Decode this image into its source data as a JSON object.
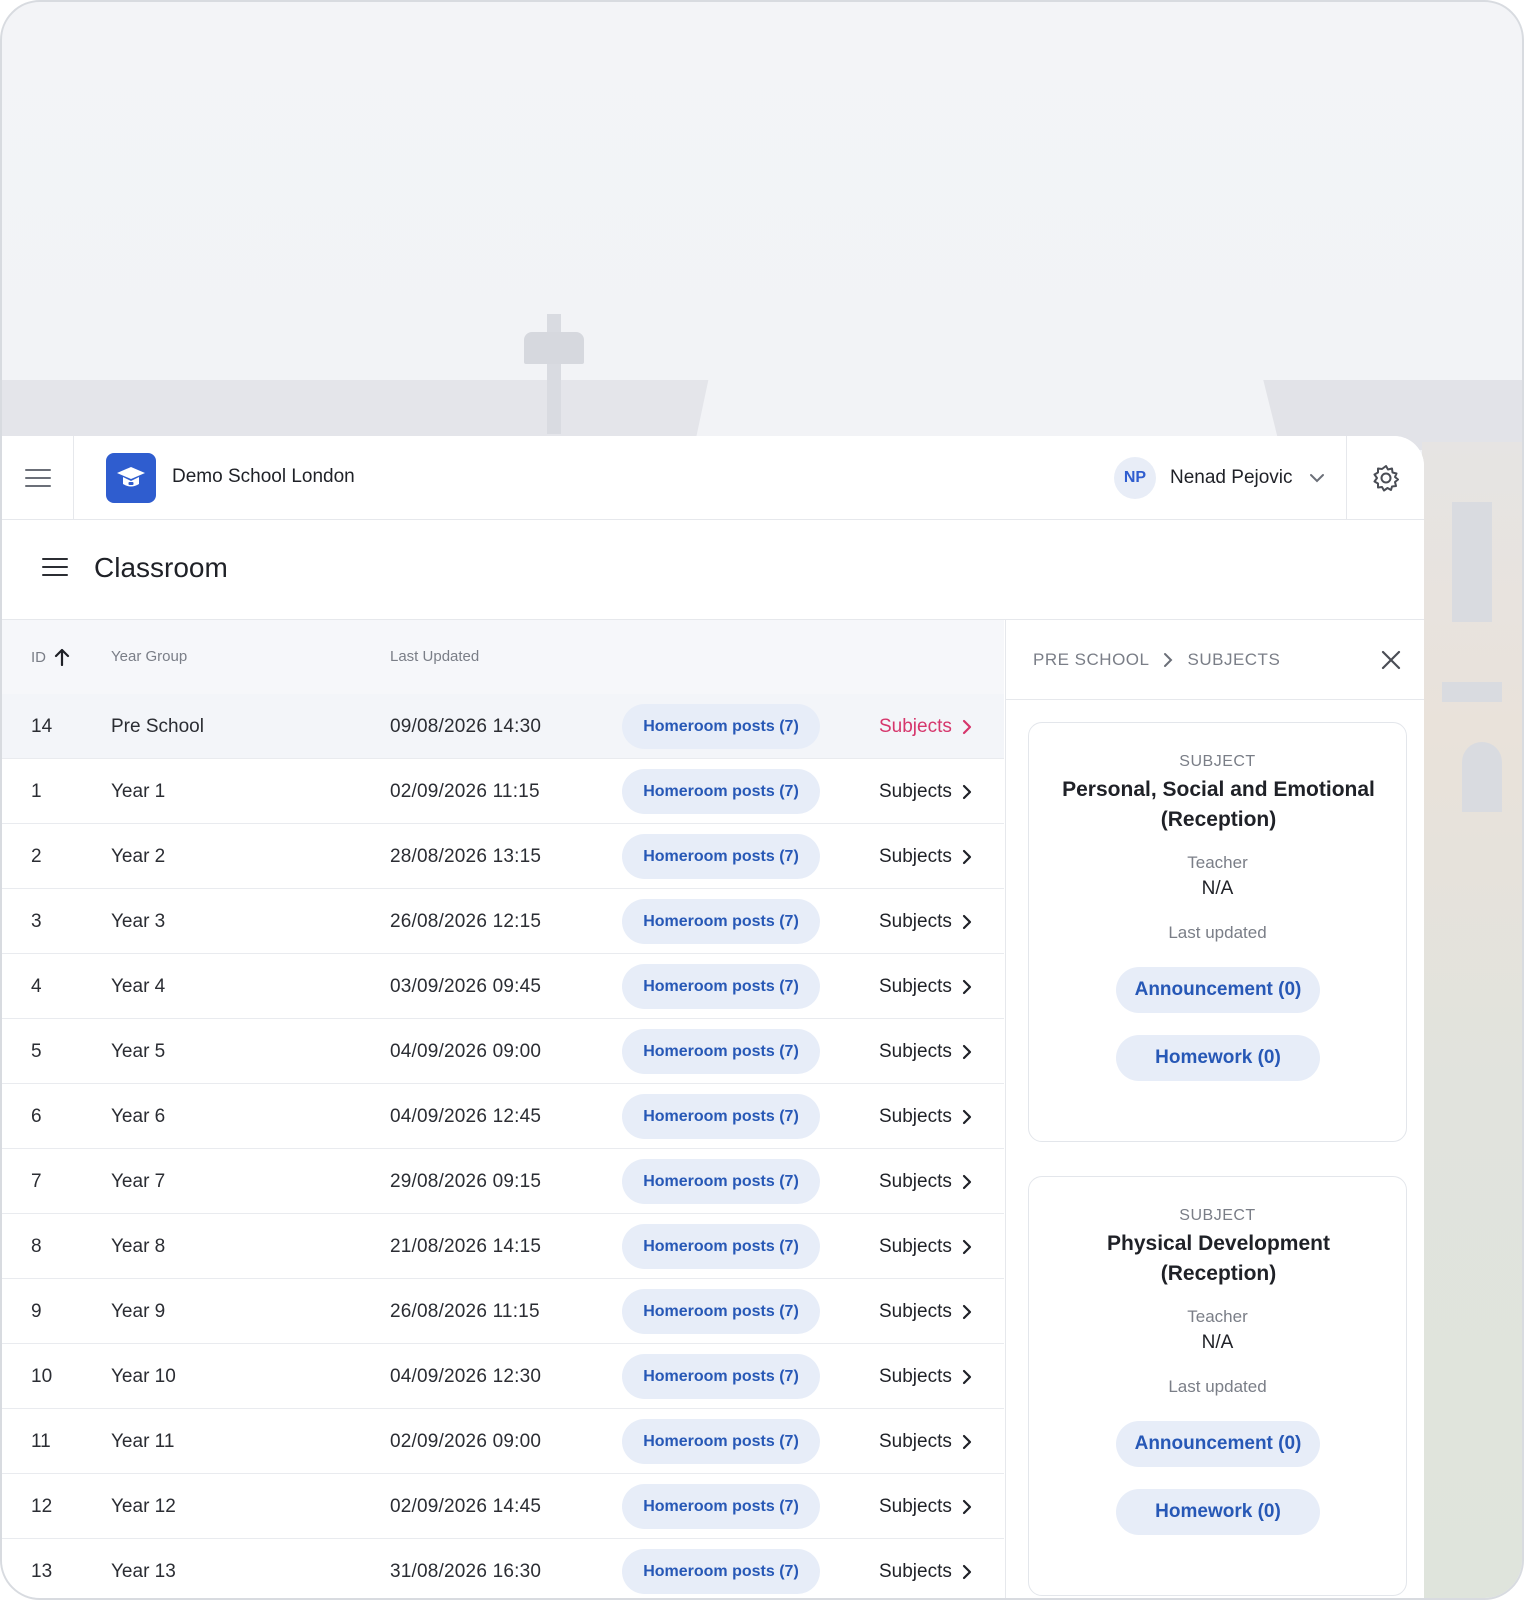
{
  "header": {
    "school_name": "Demo School London",
    "user_initials": "NP",
    "user_name": "Nenad Pejovic"
  },
  "page": {
    "title": "Classroom"
  },
  "table": {
    "columns": {
      "id": "ID",
      "year_group": "Year Group",
      "last_updated": "Last Updated"
    },
    "rows": [
      {
        "id": "14",
        "year": "Pre School",
        "updated": "09/08/2026 14:30",
        "posts": "Homeroom posts (7)",
        "subjects": "Subjects"
      },
      {
        "id": "1",
        "year": "Year 1",
        "updated": "02/09/2026 11:15",
        "posts": "Homeroom posts (7)",
        "subjects": "Subjects"
      },
      {
        "id": "2",
        "year": "Year 2",
        "updated": "28/08/2026 13:15",
        "posts": "Homeroom posts (7)",
        "subjects": "Subjects"
      },
      {
        "id": "3",
        "year": "Year 3",
        "updated": "26/08/2026 12:15",
        "posts": "Homeroom posts (7)",
        "subjects": "Subjects"
      },
      {
        "id": "4",
        "year": "Year 4",
        "updated": "03/09/2026 09:45",
        "posts": "Homeroom posts (7)",
        "subjects": "Subjects"
      },
      {
        "id": "5",
        "year": "Year 5",
        "updated": "04/09/2026 09:00",
        "posts": "Homeroom posts (7)",
        "subjects": "Subjects"
      },
      {
        "id": "6",
        "year": "Year 6",
        "updated": "04/09/2026 12:45",
        "posts": "Homeroom posts (7)",
        "subjects": "Subjects"
      },
      {
        "id": "7",
        "year": "Year 7",
        "updated": "29/08/2026 09:15",
        "posts": "Homeroom posts (7)",
        "subjects": "Subjects"
      },
      {
        "id": "8",
        "year": "Year 8",
        "updated": "21/08/2026 14:15",
        "posts": "Homeroom posts (7)",
        "subjects": "Subjects"
      },
      {
        "id": "9",
        "year": "Year 9",
        "updated": "26/08/2026 11:15",
        "posts": "Homeroom posts (7)",
        "subjects": "Subjects"
      },
      {
        "id": "10",
        "year": "Year 10",
        "updated": "04/09/2026 12:30",
        "posts": "Homeroom posts (7)",
        "subjects": "Subjects"
      },
      {
        "id": "11",
        "year": "Year 11",
        "updated": "02/09/2026 09:00",
        "posts": "Homeroom posts (7)",
        "subjects": "Subjects"
      },
      {
        "id": "12",
        "year": "Year 12",
        "updated": "02/09/2026 14:45",
        "posts": "Homeroom posts (7)",
        "subjects": "Subjects"
      },
      {
        "id": "13",
        "year": "Year 13",
        "updated": "31/08/2026 16:30",
        "posts": "Homeroom posts (7)",
        "subjects": "Subjects"
      }
    ]
  },
  "panel": {
    "breadcrumb": [
      "PRE SCHOOL",
      "SUBJECTS"
    ],
    "subjects": [
      {
        "label": "SUBJECT",
        "name": "Personal, Social and Emotional (Reception)",
        "teacher_label": "Teacher",
        "teacher": "N/A",
        "updated_label": "Last updated",
        "announcement": "Announcement (0)",
        "homework": "Homework (0)"
      },
      {
        "label": "SUBJECT",
        "name": "Physical Development (Reception)",
        "teacher_label": "Teacher",
        "teacher": "N/A",
        "updated_label": "Last updated",
        "announcement": "Announcement (0)",
        "homework": "Homework (0)"
      }
    ]
  },
  "colors": {
    "brand": "#2f5dcf",
    "pill_bg": "#e7edf8",
    "pill_text": "#2758b6",
    "active_link": "#d6366c"
  }
}
